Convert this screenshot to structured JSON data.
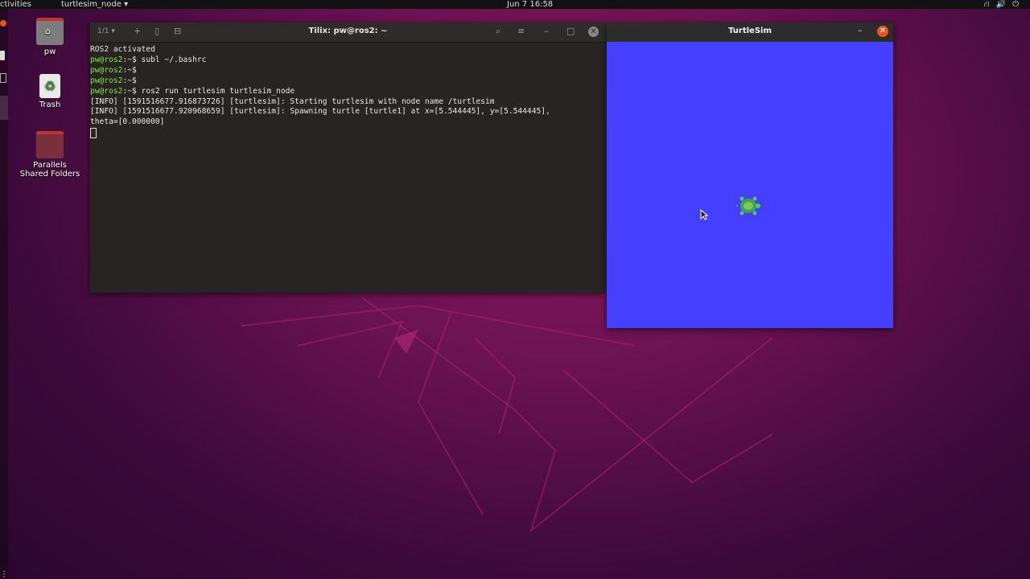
{
  "topbar": {
    "activities": "ctivities",
    "app_menu": "turtlesim_node ▾",
    "clock": "Jun 7  16:58",
    "tray_icons": [
      "network-icon",
      "volume-icon",
      "power-icon"
    ]
  },
  "desktop": {
    "icons": [
      {
        "label": "pw",
        "icon": "home-folder-icon"
      },
      {
        "label": "Trash",
        "icon": "trash-icon"
      },
      {
        "label": "Parallels Shared Folders",
        "icon": "shared-folder-icon"
      }
    ]
  },
  "terminal": {
    "title": "Tilix: pw@ros2: ~",
    "tab_counter": "1/1 ▾",
    "lines": [
      {
        "prompt": "",
        "text": "ROS2 activated"
      },
      {
        "prompt": "pw@ros2",
        "text": ":~$ subl ~/.bashrc"
      },
      {
        "prompt": "pw@ros2",
        "text": ":~$"
      },
      {
        "prompt": "pw@ros2",
        "text": ":~$"
      },
      {
        "prompt": "pw@ros2",
        "text": ":~$ ros2 run turtlesim turtlesim_node"
      },
      {
        "prompt": "",
        "text": "[INFO] [1591516677.916873726] [turtlesim]: Starting turtlesim with node name /turtlesim"
      },
      {
        "prompt": "",
        "text": "[INFO] [1591516677.920968659] [turtlesim]: Spawning turtle [turtle1] at x=[5.544445], y=[5.544445],"
      },
      {
        "prompt": "",
        "text": "theta=[0.000000]"
      }
    ]
  },
  "turtlesim": {
    "title": "TurtleSim",
    "background_color": "#4540ff"
  },
  "colors": {
    "accent": "#e95420",
    "prompt_green": "#8ae234"
  }
}
